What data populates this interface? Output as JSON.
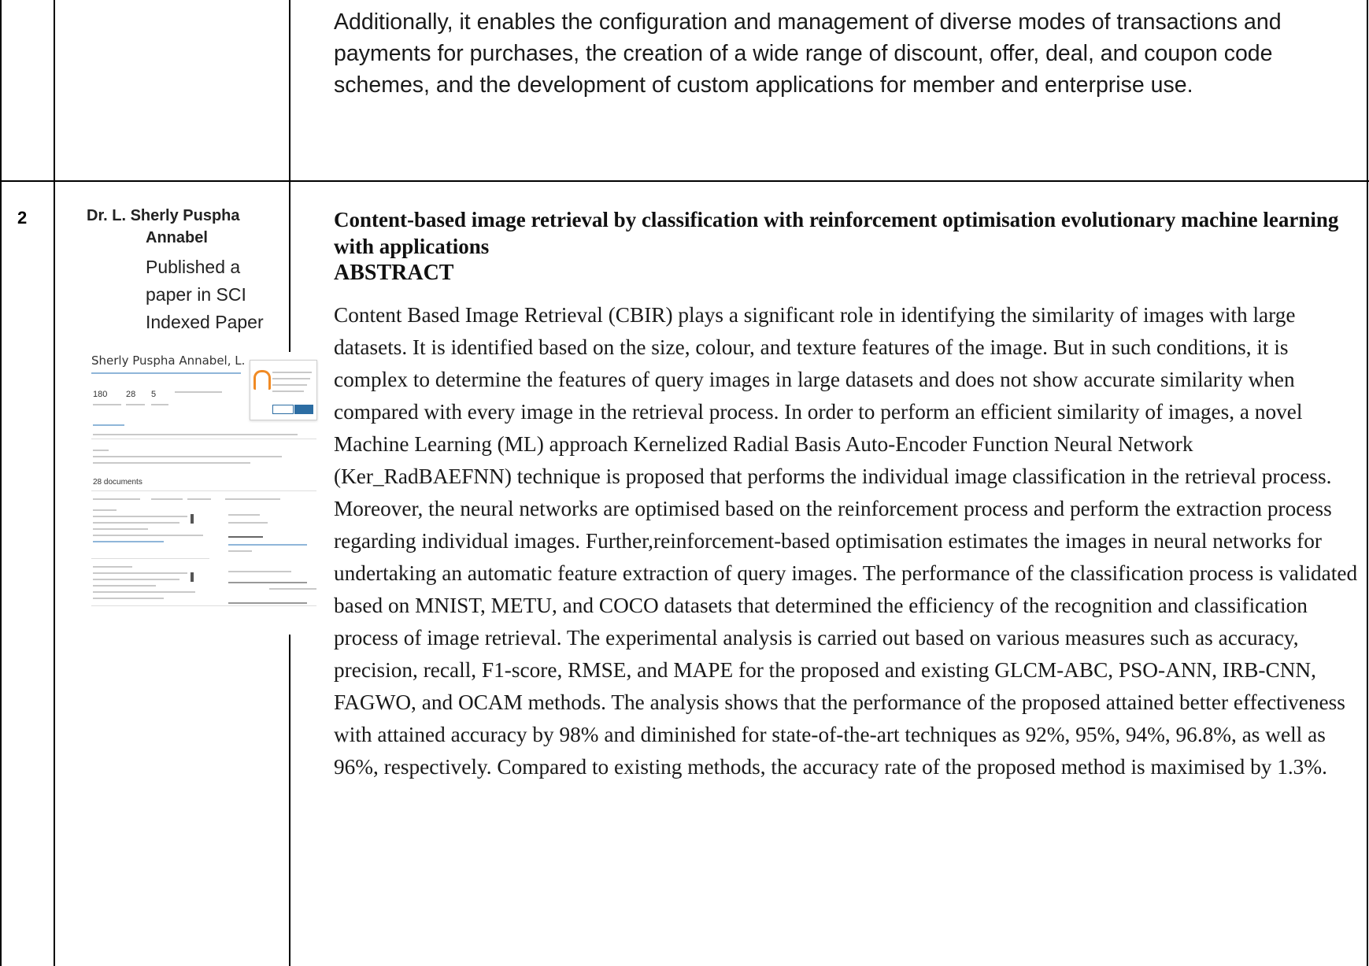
{
  "row1": {
    "intro_text": "Additionally, it enables the configuration and management of diverse modes of transactions and payments for purchases, the creation of a wide range of discount, offer, deal, and coupon code schemes, and the development of custom applications for member and enterprise use."
  },
  "row2": {
    "serial": "2",
    "author_line1": "Dr. L. Sherly Puspha",
    "author_line2": "Annabel",
    "author_desc_1": "Published a",
    "author_desc_2": "paper in SCI",
    "author_desc_3": "Indexed  Paper",
    "thumbnail": {
      "profile_name": "Sherly Puspha Annabel, L.",
      "citations": "180",
      "documents": "28",
      "h_index": "5",
      "documents_heading": "28 documents"
    },
    "paper_title": "Content-based image retrieval by classification with reinforcement optimisation evolutionary machine learning with applications",
    "abstract_heading": "ABSTRACT",
    "abstract_text": "Content Based Image Retrieval (CBIR) plays a significant role in identifying the similarity of images with large datasets. It is identified based on the size, colour, and texture features of the image. But in such conditions, it is complex to determine the features of query images in large datasets and does not show accurate similarity when compared with every image in the retrieval process. In order to perform an efficient similarity of images, a novel Machine Learning (ML) approach Kernelized Radial Basis Auto-Encoder Function Neural Network (Ker_RadBAEFNN) technique is proposed that performs the individual image classification in the retrieval process. Moreover, the neural networks are optimised based on the reinforcement process and perform the extraction process regarding individual images. Further,reinforcement-based optimisation estimates the images in neural networks for undertaking an automatic feature extraction of query images. The performance of the classification process is validated based on MNIST, METU, and COCO datasets that determined the efficiency of the recognition and classification process of image retrieval. The experimental analysis is carried out based on various measures such as accuracy, precision, recall, F1-score, RMSE, and MAPE for the proposed and existing GLCM-ABC, PSO-ANN, IRB-CNN, FAGWO, and OCAM methods. The analysis shows that the performance of the proposed attained better effectiveness with attained accuracy by 98% and diminished for state-of-the-art techniques as 92%, 95%, 94%, 96.8%, as well as 96%, respectively. Compared to existing methods, the accuracy rate of the proposed method is maximised by 1.3%."
  }
}
